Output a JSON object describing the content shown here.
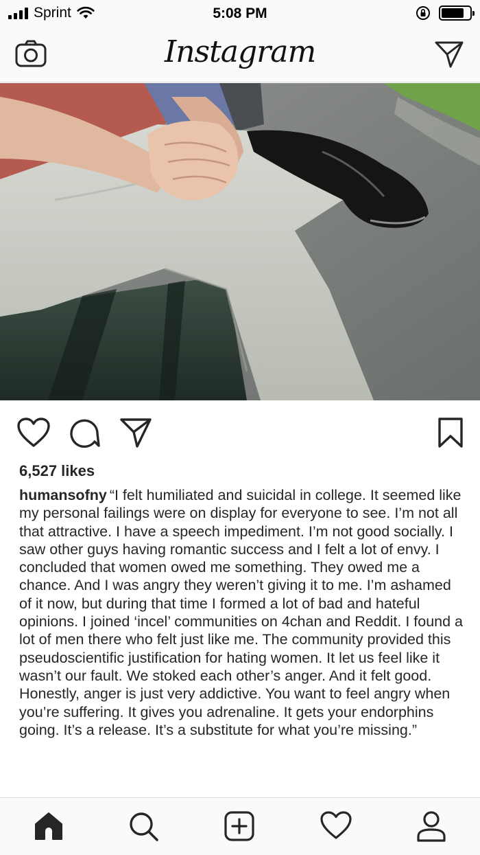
{
  "status_bar": {
    "carrier": "Sprint",
    "time": "5:08 PM",
    "signal_icon": "signal-bars-icon",
    "wifi_icon": "wifi-icon",
    "lock_icon": "rotation-lock-icon",
    "battery_level": 0.8
  },
  "header": {
    "logo_text": "Instagram",
    "left_icon": "camera-icon",
    "right_icon": "direct-message-icon"
  },
  "post": {
    "image_alt": "photo-person-on-bench",
    "actions": [
      "heart-icon",
      "comment-icon",
      "share-icon",
      "bookmark-icon"
    ],
    "likes": "6,527 likes",
    "username": "humansofny",
    "caption": "“I felt humiliated and suicidal in college.  It seemed like my personal failings were on display for everyone to see.  I’m not all that attractive.  I have a speech impediment.  I’m not good socially.  I saw other guys having romantic success and I felt a lot of envy.  I concluded that women owed me something.  They owed me a chance.  And I was angry they weren’t giving it to me.  I’m ashamed of it now, but during that time I formed a lot of bad and hateful opinions.  I joined ‘incel’ communities on 4chan and Reddit.  I found a lot of men there who felt just like me.  The community provided this pseudoscientific justification for hating women.  It let us feel like it wasn’t our fault.  We stoked each other’s anger.  And it felt good.  Honestly, anger is just very addictive.  You want to feel angry when you’re suffering.  It gives you adrenaline.  It gets your endorphins going.  It’s a release.  It’s a substitute for what you’re missing.”"
  },
  "tab_bar": {
    "items": [
      "home-icon",
      "search-icon",
      "new-post-icon",
      "activity-icon",
      "profile-icon"
    ]
  },
  "colors": {
    "bar_background": "#fafafa",
    "divider": "#dbdbdb",
    "text": "#262626"
  }
}
